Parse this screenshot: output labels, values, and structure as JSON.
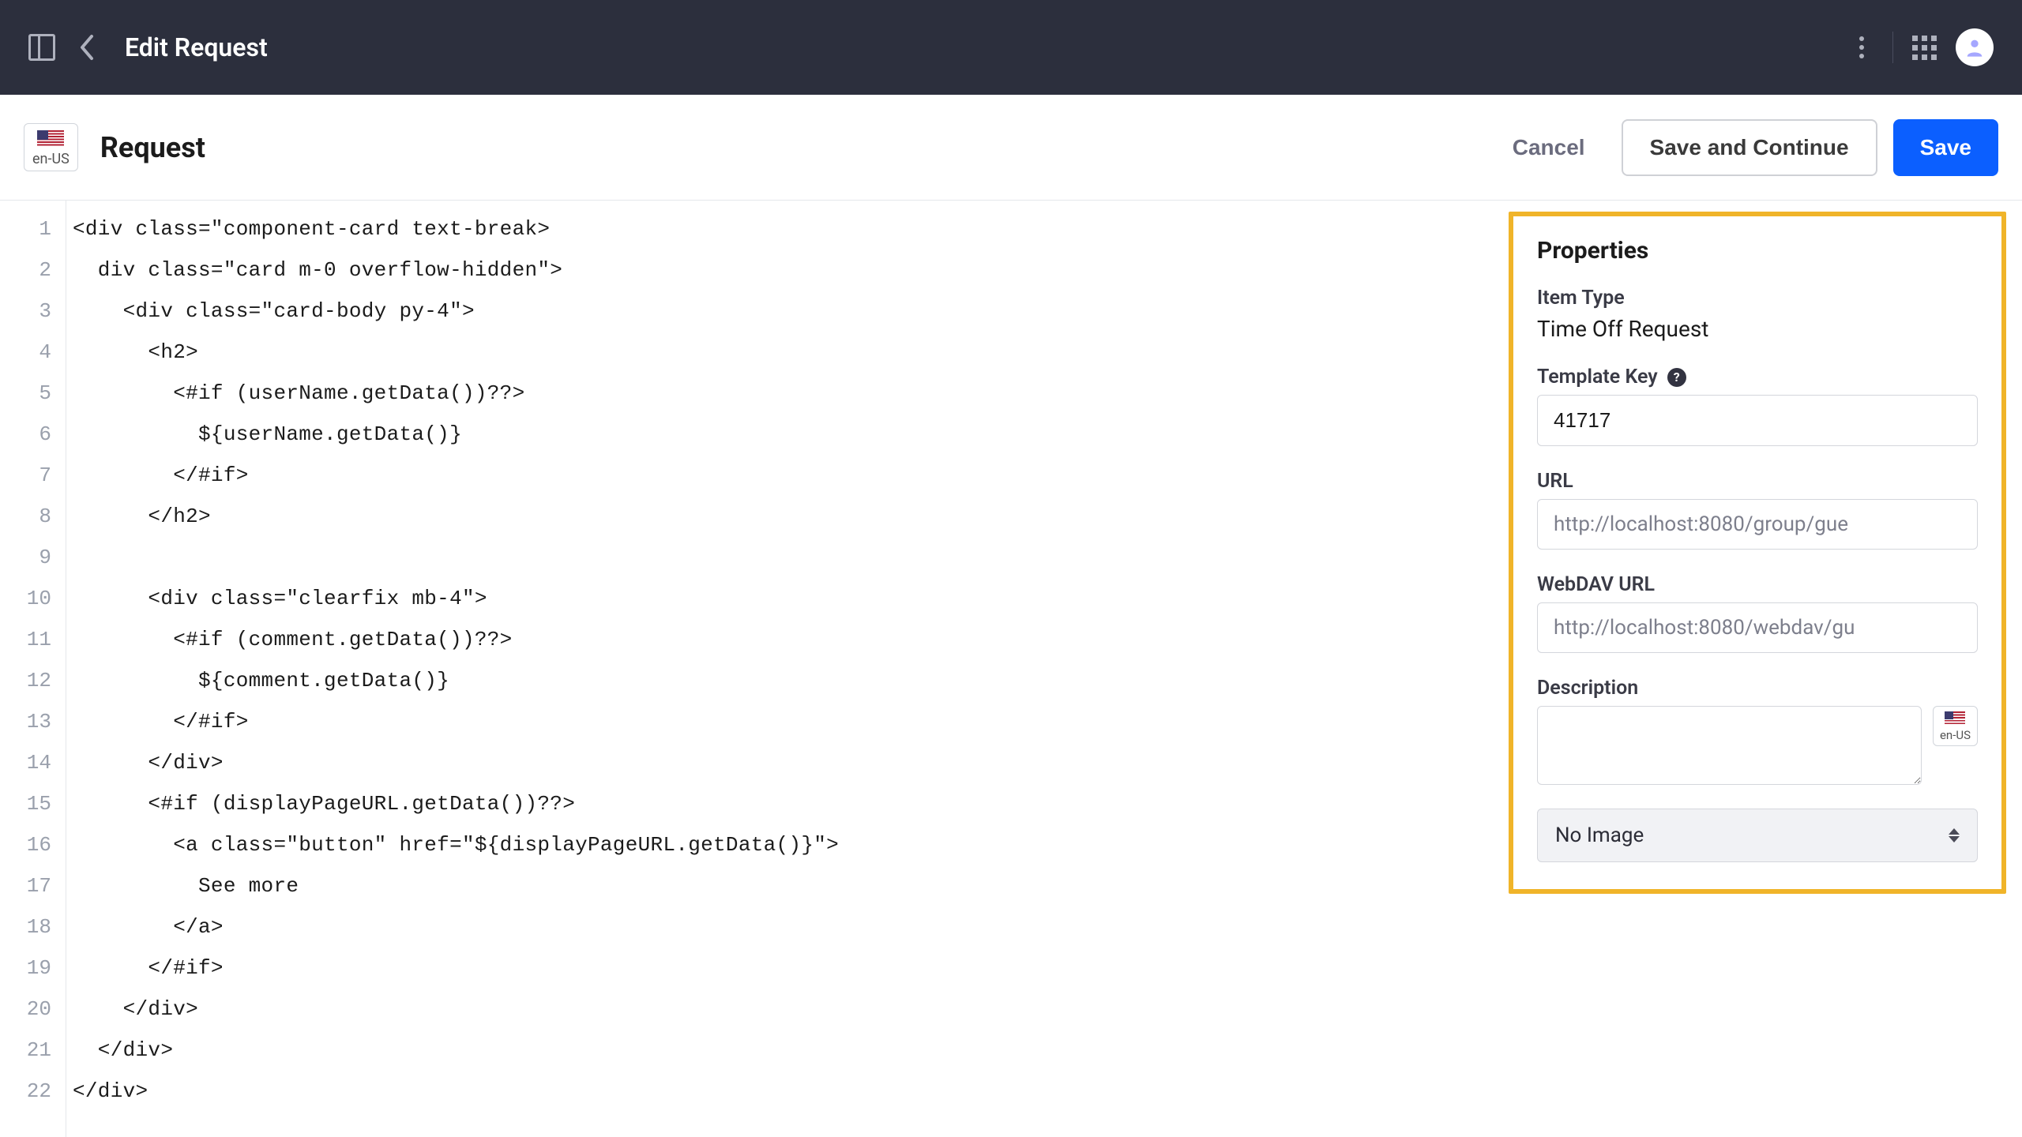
{
  "topbar": {
    "title": "Edit Request"
  },
  "locale": {
    "code": "en-US"
  },
  "subbar": {
    "title": "Request",
    "cancel": "Cancel",
    "save_continue": "Save and Continue",
    "save": "Save"
  },
  "code_lines": [
    "<div class=\"component-card text-break>",
    "  div class=\"card m-0 overflow-hidden\">",
    "    <div class=\"card-body py-4\">",
    "      <h2>",
    "        <#if (userName.getData())??>",
    "          ${userName.getData()}",
    "        </#if>",
    "      </h2>",
    "",
    "      <div class=\"clearfix mb-4\">",
    "        <#if (comment.getData())??>",
    "          ${comment.getData()}",
    "        </#if>",
    "      </div>",
    "      <#if (displayPageURL.getData())??>",
    "        <a class=\"button\" href=\"${displayPageURL.getData()}\">",
    "          See more",
    "        </a>",
    "      </#if>",
    "    </div>",
    "  </div>",
    "</div>"
  ],
  "properties": {
    "title": "Properties",
    "item_type_label": "Item Type",
    "item_type_value": "Time Off Request",
    "template_key_label": "Template Key",
    "template_key_value": "41717",
    "url_label": "URL",
    "url_value": "http://localhost:8080/group/gue",
    "webdav_label": "WebDAV URL",
    "webdav_value": "http://localhost:8080/webdav/gu",
    "description_label": "Description",
    "description_value": "",
    "image_select": "No Image"
  }
}
